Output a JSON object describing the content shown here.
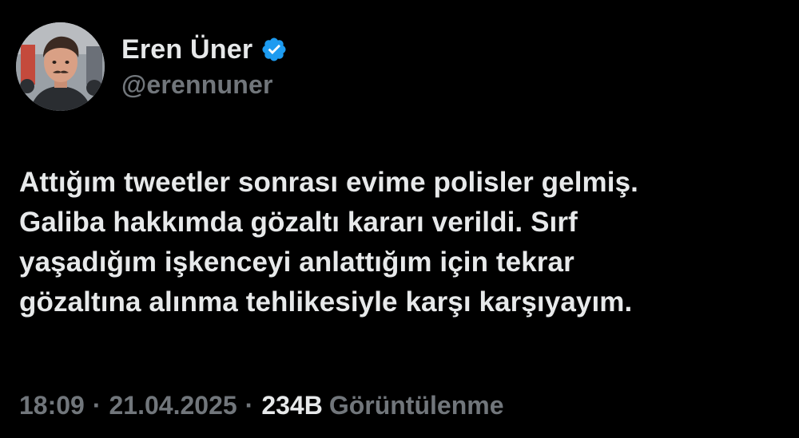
{
  "author": {
    "display_name": "Eren Üner",
    "handle": "@erennuner",
    "verified_icon": "verified-badge-icon",
    "verified_color": "#1d9bf0"
  },
  "tweet": {
    "lines": [
      "Attığım tweetler sonrası evime polisler gelmiş.",
      "Galiba hakkımda gözaltı kararı verildi. Sırf",
      "yaşadığım işkenceyi anlattığım için tekrar",
      "gözaltına alınma tehlikesiyle karşı karşıyayım."
    ]
  },
  "meta": {
    "time": "18:09",
    "separator": "·",
    "date": "21.04.2025",
    "views_count": "234B",
    "views_label": "Görüntülenme"
  },
  "colors": {
    "background": "#000000",
    "primary_text": "#e7e9ea",
    "secondary_text": "#71767b"
  }
}
